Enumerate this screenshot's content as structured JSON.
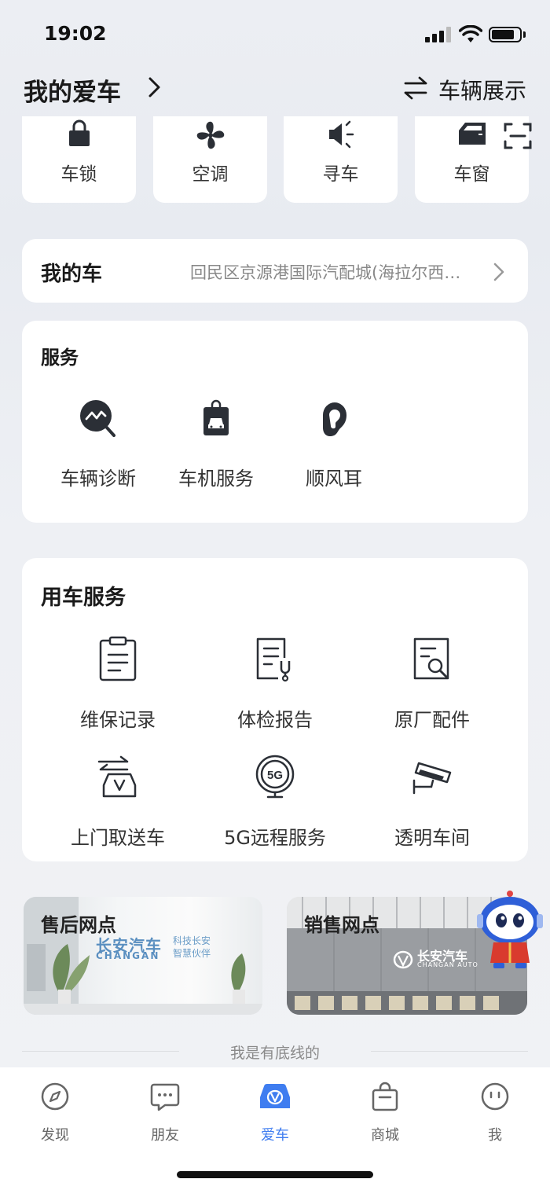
{
  "status_bar": {
    "time": "19:02"
  },
  "header": {
    "title": "我的爱车",
    "right_label": "车辆展示"
  },
  "quick_controls": [
    {
      "label": "车锁",
      "icon": "lock-icon"
    },
    {
      "label": "空调",
      "icon": "fan-icon"
    },
    {
      "label": "寻车",
      "icon": "horn-icon"
    },
    {
      "label": "车窗",
      "icon": "car-window-icon"
    }
  ],
  "my_car": {
    "title": "我的车",
    "address": "回民区京源港国际汽配城(海拉尔西…"
  },
  "services": {
    "title": "服务",
    "items": [
      {
        "label": "车辆诊断",
        "icon": "diagnosis-icon"
      },
      {
        "label": "车机服务",
        "icon": "car-machine-service-icon"
      },
      {
        "label": "顺风耳",
        "icon": "ear-icon"
      }
    ]
  },
  "car_services": {
    "title": "用车服务",
    "items": [
      {
        "label": "维保记录",
        "icon": "clipboard-icon"
      },
      {
        "label": "体检报告",
        "icon": "checkup-report-icon"
      },
      {
        "label": "原厂配件",
        "icon": "parts-search-icon"
      },
      {
        "label": "上门取送车",
        "icon": "pickup-delivery-icon"
      },
      {
        "label": "5G远程服务",
        "icon": "5g-icon"
      },
      {
        "label": "透明车间",
        "icon": "camera-icon"
      }
    ]
  },
  "banners": {
    "after_sales": {
      "title": "售后网点",
      "logo_cn": "长安汽车",
      "logo_en": "CHANGAN",
      "slogan_1": "科技长安",
      "slogan_2": "智慧伙伴"
    },
    "sales": {
      "title": "销售网点",
      "logo_cn": "长安汽车",
      "logo_en": "CHANGAN AUTO"
    }
  },
  "footer_note": "我是有底线的",
  "tabs": [
    {
      "label": "发现",
      "icon": "compass-icon",
      "active": false
    },
    {
      "label": "朋友",
      "icon": "chat-icon",
      "active": false
    },
    {
      "label": "爱车",
      "icon": "car-icon",
      "active": true
    },
    {
      "label": "商城",
      "icon": "shopping-bag-icon",
      "active": false
    },
    {
      "label": "我",
      "icon": "face-icon",
      "active": false
    }
  ],
  "colors": {
    "accent": "#3f7df0",
    "icon_dark": "#2b2f36",
    "background": "#eceef3"
  }
}
